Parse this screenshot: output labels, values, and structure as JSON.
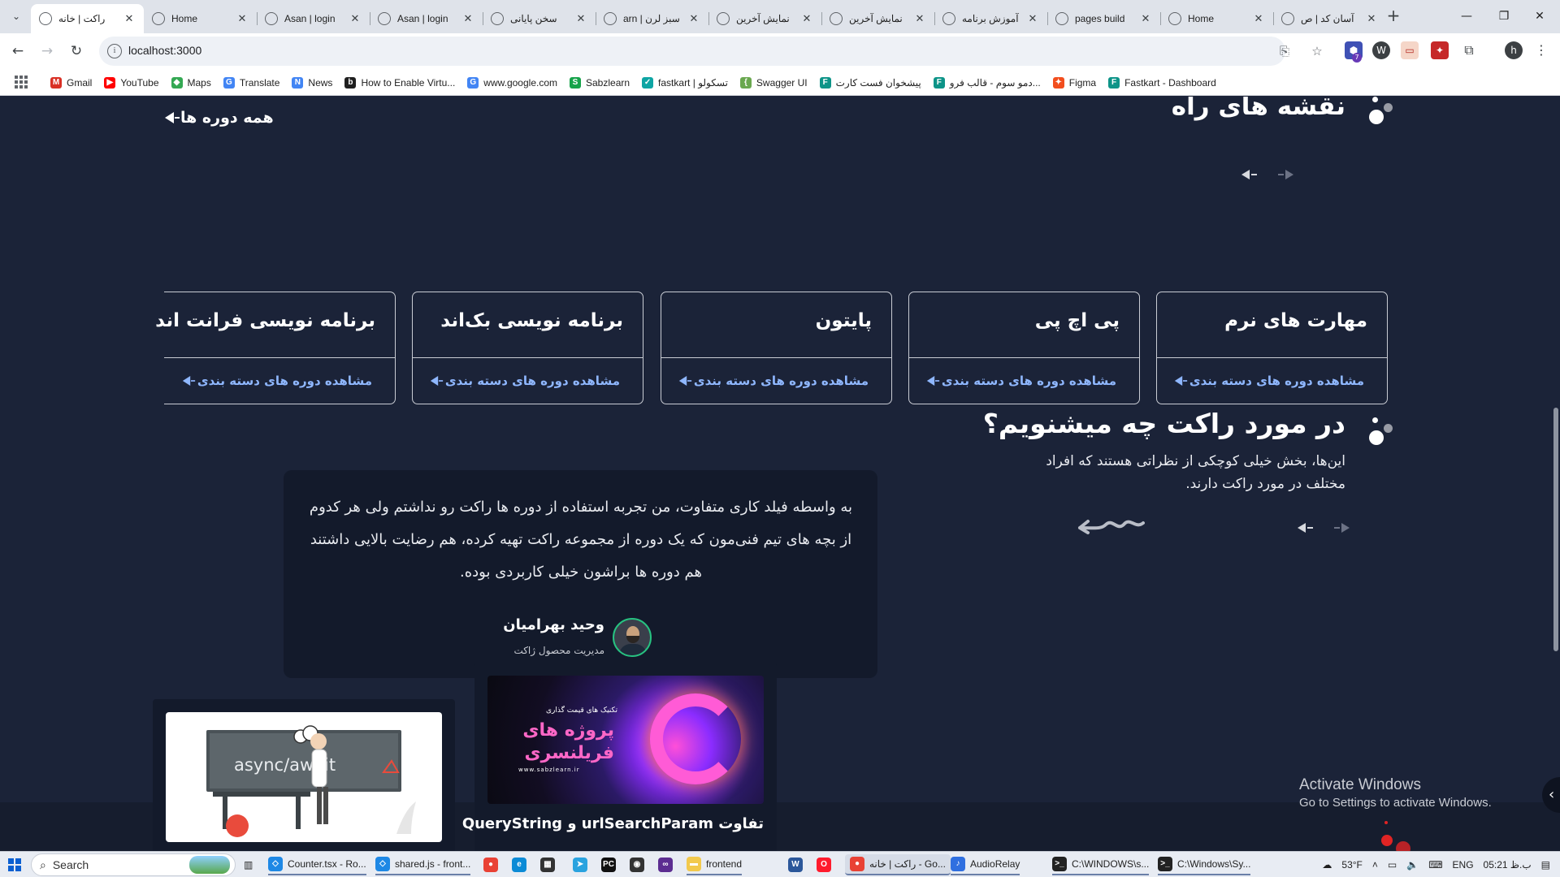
{
  "browser": {
    "tabs": [
      {
        "title": "راکت | خانه",
        "active": true
      },
      {
        "title": "Home"
      },
      {
        "title": "Asan | login"
      },
      {
        "title": "Asan | login"
      },
      {
        "title": "سخن پایانی"
      },
      {
        "title": "سبز لرن | arn"
      },
      {
        "title": "نمایش آخرین"
      },
      {
        "title": "نمایش آخرین"
      },
      {
        "title": "آموزش برنامه"
      },
      {
        "title": "pages build"
      },
      {
        "title": "Home"
      },
      {
        "title": "آسان کد | ص"
      }
    ],
    "url": "localhost:3000",
    "extension_badge": "7",
    "profile_initial": "h",
    "bookmarks": [
      {
        "label": "Gmail",
        "icon": "gmail-icon",
        "color": "#d93025",
        "glyph": "M"
      },
      {
        "label": "YouTube",
        "icon": "youtube-icon",
        "color": "#ff0000",
        "glyph": "▶"
      },
      {
        "label": "Maps",
        "icon": "maps-icon",
        "color": "#34a853",
        "glyph": "◆"
      },
      {
        "label": "Translate",
        "icon": "translate-icon",
        "color": "#4285f4",
        "glyph": "G"
      },
      {
        "label": "News",
        "icon": "news-icon",
        "color": "#4285f4",
        "glyph": "N"
      },
      {
        "label": "How to Enable Virtu...",
        "icon": "bookmark-icon",
        "color": "#1f1f1f",
        "glyph": "b"
      },
      {
        "label": "www.google.com",
        "icon": "google-icon",
        "color": "#4285f4",
        "glyph": "G"
      },
      {
        "label": "Sabzlearn",
        "icon": "sabzlearn-icon",
        "color": "#16a34a",
        "glyph": "S"
      },
      {
        "label": "fastkart | تسکولو",
        "icon": "fastkart-icon",
        "color": "#0ea5a4",
        "glyph": "✓"
      },
      {
        "label": "Swagger UI",
        "icon": "swagger-icon",
        "color": "#6aa84f",
        "glyph": "{"
      },
      {
        "label": "پیشخوان فست کارت",
        "icon": "f-icon",
        "color": "#0d9488",
        "glyph": "F"
      },
      {
        "label": "دمو سوم - قالب فرو...",
        "icon": "f-icon",
        "color": "#0d9488",
        "glyph": "F"
      },
      {
        "label": "Figma",
        "icon": "figma-icon",
        "color": "#f24e1e",
        "glyph": "✦"
      },
      {
        "label": "Fastkart - Dashboard",
        "icon": "f-icon",
        "color": "#0d9488",
        "glyph": "F"
      }
    ]
  },
  "page": {
    "roadmaps": {
      "title": "نقشه های راه",
      "all_link": "همه دوره ها",
      "card_link": "مشاهده دوره های دسته بندی",
      "cards": [
        {
          "title": "مهارت های نرم"
        },
        {
          "title": "پی اچ پی"
        },
        {
          "title": "پایتون"
        },
        {
          "title": "برنامه نویسی بک‌اند"
        },
        {
          "title": "برنامه نویسی فرانت اند"
        }
      ]
    },
    "testimonials": {
      "title": "در مورد راکت چه میشنویم؟",
      "subtitle": "این‌ها، بخش خیلی کوچکی از نظراتی هستند که افراد مختلف در مورد راکت دارند.",
      "quote": "به واسطه فیلد کاری متفاوت، من تجربه استفاده از دوره ها راکت رو نداشتم ولی هر کدوم از بچه های تیم فنی‌مون که یک دوره از مجموعه راکت تهیه کرده، هم رضایت بالایی داشتند هم دوره ها براشون خیلی کاربردی بوده.",
      "author": "وحید بهرامیان",
      "role": "مدیریت محصول ژاکت"
    },
    "articles": [
      {
        "title": "",
        "thumb_text": "async/await"
      },
      {
        "title": "تفاوت urlSearchParam و QueryString",
        "thumb_small": "تکنیک های قیمت گذاری",
        "thumb_big": "پروژه های فریلنسری",
        "thumb_url": "www.sabzlearn.ir"
      }
    ],
    "watermark": {
      "line1": "Activate Windows",
      "line2": "Go to Settings to activate Windows."
    }
  },
  "taskbar": {
    "search_placeholder": "Search",
    "apps": [
      {
        "label": "Counter.tsx - Ro...",
        "icon": "vscode-icon",
        "color": "#1e88e5",
        "glyph": "◇"
      },
      {
        "label": "shared.js - front...",
        "icon": "vscode-icon",
        "color": "#1e88e5",
        "glyph": "◇"
      },
      {
        "label": "",
        "icon": "chrome-icon",
        "color": "#e94235",
        "glyph": "●"
      },
      {
        "label": "",
        "icon": "edge-icon",
        "color": "#0c8bd6",
        "glyph": "e"
      },
      {
        "label": "",
        "icon": "store-icon",
        "color": "#333333",
        "glyph": "▦"
      },
      {
        "label": "",
        "icon": "telegram-icon",
        "color": "#2aa3df",
        "glyph": "➤"
      },
      {
        "label": "",
        "icon": "pycharm-icon",
        "color": "#111111",
        "glyph": "PC"
      },
      {
        "label": "",
        "icon": "obs-icon",
        "color": "#333333",
        "glyph": "◉"
      },
      {
        "label": "",
        "icon": "vs-icon",
        "color": "#5c2d91",
        "glyph": "∞"
      },
      {
        "label": "frontend",
        "icon": "folder-icon",
        "color": "#f2c94c",
        "glyph": "▬"
      },
      {
        "label": "",
        "icon": "word-icon",
        "color": "#2b579a",
        "glyph": "W"
      },
      {
        "label": "",
        "icon": "opera-icon",
        "color": "#ff1b2d",
        "glyph": "O"
      },
      {
        "label": "راکت | خانه - Go...",
        "icon": "chrome-icon",
        "color": "#e94235",
        "glyph": "●"
      },
      {
        "label": "AudioRelay",
        "icon": "audiorelay-icon",
        "color": "#2f6fe0",
        "glyph": "♪"
      },
      {
        "label": "C:\\WINDOWS\\s...",
        "icon": "cmd-icon",
        "color": "#222222",
        "glyph": ">_"
      },
      {
        "label": "C:\\Windows\\Sy...",
        "icon": "cmd-icon",
        "color": "#222222",
        "glyph": ">_"
      }
    ],
    "weather": "53°F",
    "language": "ENG",
    "time": "05:21 ب.ظ"
  }
}
